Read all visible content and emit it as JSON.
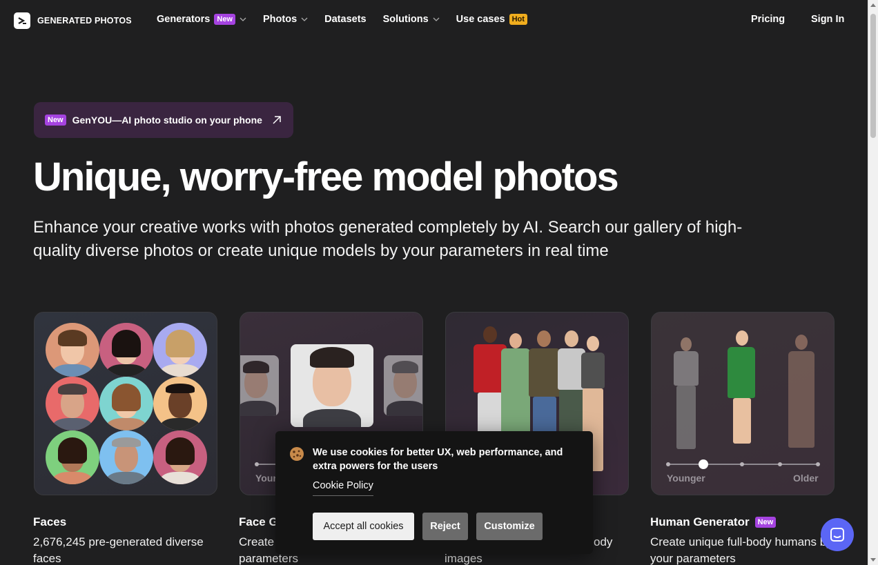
{
  "header": {
    "logo_text": "GENERATED PHOTOS",
    "nav": [
      {
        "label": "Generators",
        "badge": "New",
        "has_dropdown": true
      },
      {
        "label": "Photos",
        "has_dropdown": true
      },
      {
        "label": "Datasets",
        "has_dropdown": false
      },
      {
        "label": "Solutions",
        "has_dropdown": true
      },
      {
        "label": "Use cases",
        "badge": "Hot",
        "has_dropdown": false
      }
    ],
    "pricing": "Pricing",
    "sign_in": "Sign In"
  },
  "promo": {
    "badge": "New",
    "text": "GenYOU—AI photo studio on your phone",
    "icon": "arrow-up-right-icon"
  },
  "hero": {
    "title": "Unique, worry-free model photos",
    "subtitle": "Enhance your creative works with photos generated completely by AI. Search our gallery of high-quality diverse photos or create unique models by your parameters in real time"
  },
  "cards": [
    {
      "title": "Faces",
      "badge": "",
      "desc": "2,676,245 pre-generated diverse faces"
    },
    {
      "title": "Face G",
      "badge": "",
      "desc": "Create",
      "desc2": "parameters",
      "slider_left": "Your"
    },
    {
      "title": "",
      "badge": "",
      "desc": "ody",
      "desc2": "images"
    },
    {
      "title": "Human Generator",
      "badge": "New",
      "desc": "Create unique full-body humans by your parameters",
      "slider_left": "Younger",
      "slider_right": "Older"
    }
  ],
  "cookie": {
    "icon": "cookie-icon",
    "text": "We use cookies for better UX, web performance, and extra powers for the users",
    "policy_link": "Cookie Policy",
    "accept": "Accept all cookies",
    "reject": "Reject",
    "customize": "Customize"
  },
  "chat": {
    "icon": "chat-icon"
  },
  "colors": {
    "background": "#1f1f20",
    "badge_new": "#a543e0",
    "badge_hot": "#f0ad1e",
    "promo_bg": "#3a2540",
    "chat": "#5b66f5"
  }
}
